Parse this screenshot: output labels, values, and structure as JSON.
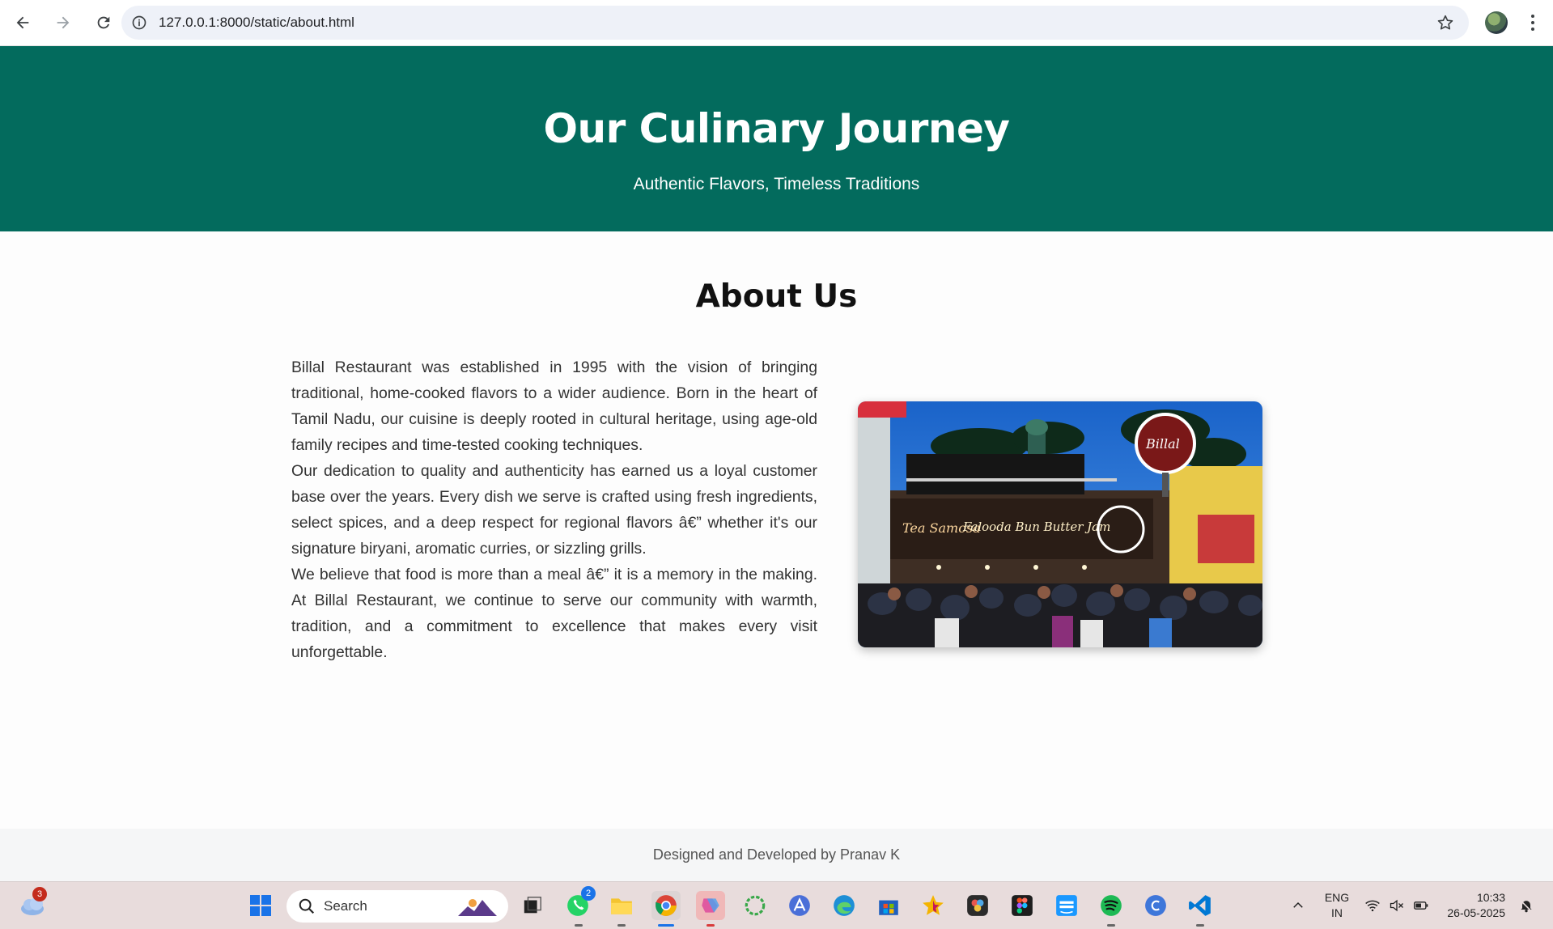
{
  "browser": {
    "url": "127.0.0.1:8000/static/about.html"
  },
  "hero": {
    "title": "Our Culinary Journey",
    "subtitle": "Authentic Flavors, Timeless Traditions"
  },
  "about": {
    "heading": "About Us",
    "paragraphs": [
      "Billal Restaurant was established in 1995 with the vision of bringing traditional, home-cooked flavors to a wider audience. Born in the heart of Tamil Nadu, our cuisine is deeply rooted in cultural heritage, using age-old family recipes and time-tested cooking techniques.",
      "Our dedication to quality and authenticity has earned us a loyal customer base over the years. Every dish we serve is crafted using fresh ingredients, select spices, and a deep respect for regional flavors â€” whether it's our signature biryani, aromatic curries, or sizzling grills.",
      "We believe that food is more than a meal â€” it is a memory in the making. At Billal Restaurant, we continue to serve our community with warmth, tradition, and a commitment to excellence that makes every visit unforgettable."
    ],
    "photo_signs": {
      "left": "Tea Samosa",
      "middle": "Falooda Bun Butter Jam",
      "logo": "Billal"
    }
  },
  "footer": {
    "text": "Designed and Developed by Pranav K"
  },
  "taskbar": {
    "weather_badge": "3",
    "search_label": "Search",
    "whatsapp_badge": "2",
    "language_line1": "ENG",
    "language_line2": "IN",
    "time": "10:33",
    "date": "26-05-2025"
  }
}
